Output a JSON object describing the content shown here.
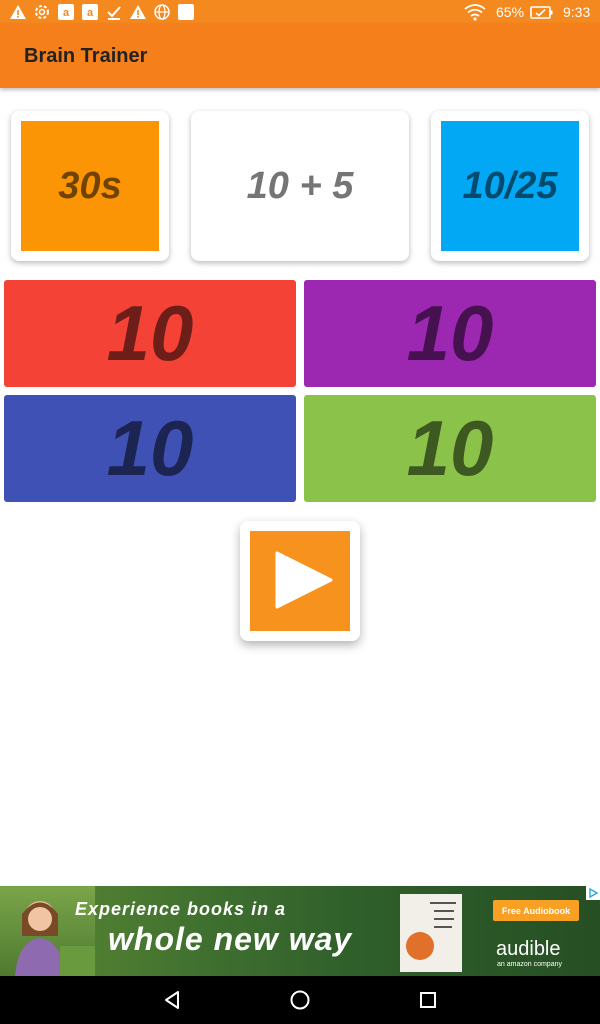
{
  "status_bar": {
    "battery": "65%",
    "time": "9:33",
    "icons": [
      "warning-icon",
      "settings-icon",
      "amazon-icon",
      "amazon-icon",
      "check-download-icon",
      "warning-icon",
      "globe-icon",
      "square-icon",
      "wifi-icon",
      "battery-icon"
    ]
  },
  "app": {
    "title": "Brain Trainer"
  },
  "timer": {
    "text": "30s",
    "color": "#fb9505"
  },
  "question": {
    "text": "10 + 5"
  },
  "score": {
    "text": "10/25",
    "color": "#03a8f4"
  },
  "answers": [
    {
      "label": "10",
      "color": "#f44336"
    },
    {
      "label": "10",
      "color": "#9c27b0"
    },
    {
      "label": "10",
      "color": "#3f51b5"
    },
    {
      "label": "10",
      "color": "#8bc34a"
    }
  ],
  "play_button": {
    "icon": "play-icon",
    "color": "#f8921e"
  },
  "ad": {
    "line1": "Experience books in a",
    "line2": "whole new way",
    "button": "Free Audiobook",
    "brand": "audible",
    "brand_sub": "an amazon company",
    "book_title": "MICHAEL POLLAN · THE BOTANY OF DESIRE"
  },
  "nav": [
    "back-icon",
    "home-icon",
    "recents-icon"
  ]
}
